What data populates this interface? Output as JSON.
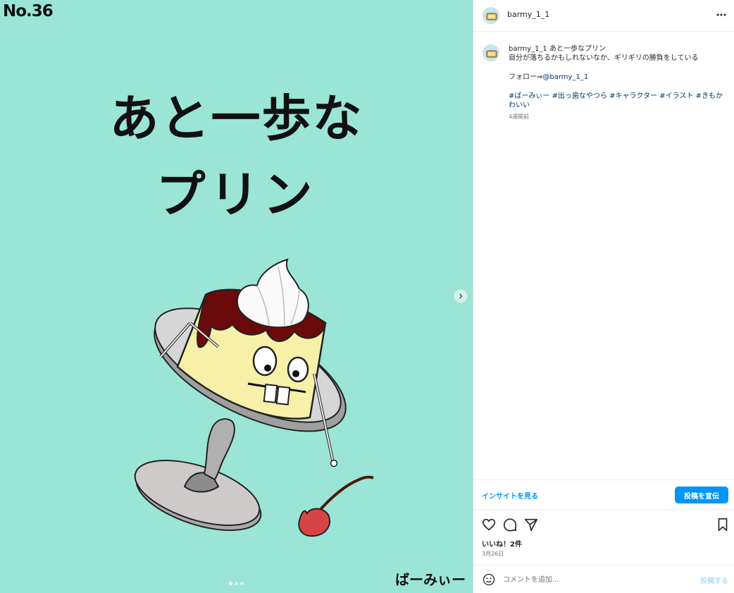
{
  "media": {
    "post_number": "No.36",
    "title_line1": "あと一歩な",
    "title_line2": "プリン",
    "signature": "ばーみぃー",
    "colors": {
      "background": "#9be5d6",
      "pudding": "#f7f0a8",
      "caramel": "#6b0a0a",
      "dish": "#b3b3b3",
      "cherry": "#d64545"
    },
    "carousel_dots": 3,
    "active_dot": 0
  },
  "header": {
    "username": "barmy_1_1",
    "more_icon": "more-horizontal-icon"
  },
  "caption": {
    "username": "barmy_1_1",
    "title": "あと一歩なプリン",
    "line1": "自分が落ちるかもしれないなか、ギリギリの勝負をしている",
    "follow_prefix": "フォロー⇒",
    "follow_handle": "@barmy_1_1",
    "hashtags": "#ばーみぃー #出っ歯なやつら #キャラクター #イラスト #きもかわいい",
    "time_ago": "4週間前"
  },
  "insights": {
    "link_label": "インサイトを見る",
    "promote_label": "投稿を宣伝"
  },
  "actions": {
    "icons": [
      "heart-icon",
      "comment-icon",
      "share-icon",
      "bookmark-icon"
    ],
    "likes": "いいね！2件",
    "date": "3月26日"
  },
  "comment": {
    "placeholder": "コメントを追加...",
    "post_label": "投稿する"
  }
}
